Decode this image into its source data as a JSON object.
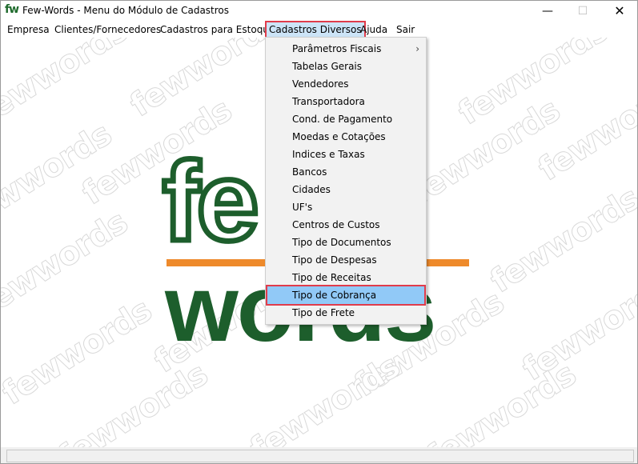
{
  "window": {
    "title": "Few-Words - Menu do Módulo de Cadastros",
    "app_icon": "fw",
    "controls": {
      "minimize": "—",
      "maximize": "☐",
      "close": "✕"
    }
  },
  "menubar": {
    "items": [
      "Empresa",
      "Clientes/Fornecedores",
      "Cadastros para Estoque",
      "Cadastros Diversos",
      "Ajuda",
      "Sair"
    ],
    "active": "Cadastros Diversos"
  },
  "dropdown": {
    "items": [
      {
        "label": "Parâmetros Fiscais",
        "submenu": true
      },
      {
        "label": "Tabelas Gerais"
      },
      {
        "label": "Vendedores"
      },
      {
        "label": "Transportadora"
      },
      {
        "label": "Cond. de Pagamento"
      },
      {
        "label": "Moedas e Cotações"
      },
      {
        "label": "Indices e Taxas"
      },
      {
        "label": "Bancos"
      },
      {
        "label": "Cidades"
      },
      {
        "label": "UF's"
      },
      {
        "label": "Centros de Custos"
      },
      {
        "label": "Tipo de Documentos"
      },
      {
        "label": "Tipo de Despesas"
      },
      {
        "label": "Tipo de Receitas"
      },
      {
        "label": "Tipo de Cobrança",
        "highlighted": true
      },
      {
        "label": "Tipo de Frete"
      }
    ],
    "submenu_arrow": "›"
  },
  "logo": {
    "top": "fe",
    "bottom": "words"
  },
  "watermark": {
    "text": "fewwords"
  },
  "colors": {
    "brand_green": "#1d5e2c",
    "brand_orange": "#ee8a2b",
    "highlight": "#91c9f7",
    "annotation_red": "#e03c4b"
  }
}
